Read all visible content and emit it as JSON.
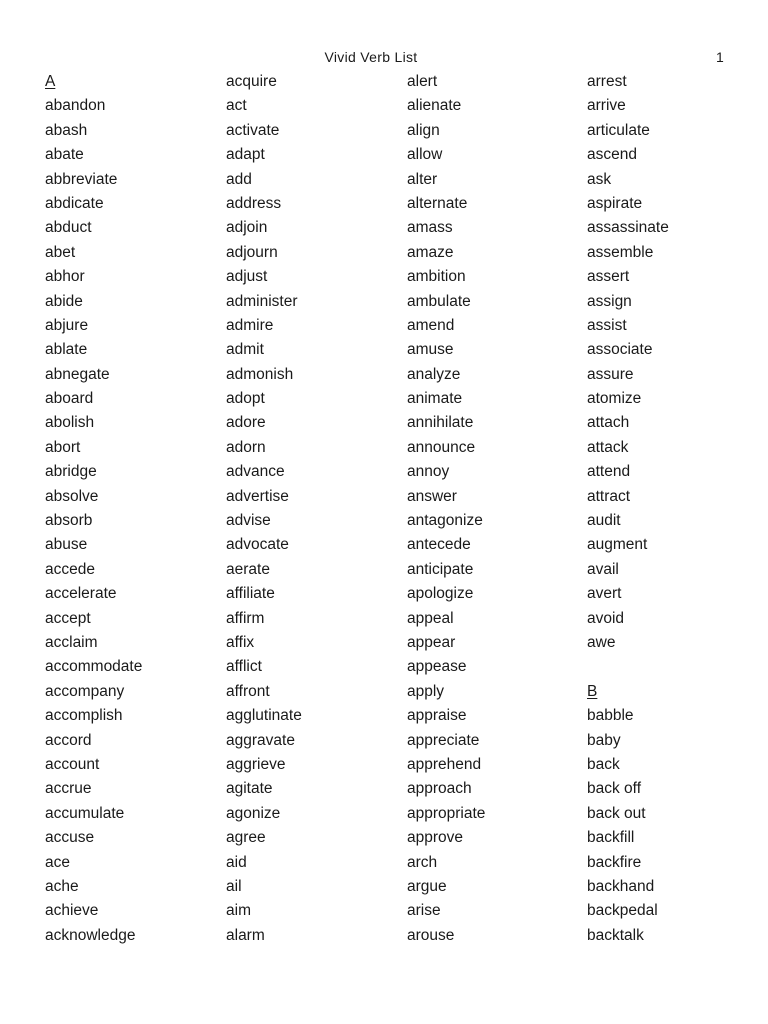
{
  "header": {
    "title": "Vivid Verb List",
    "page_number": "1"
  },
  "columns": [
    [
      {
        "type": "heading",
        "text": "A"
      },
      {
        "type": "word",
        "text": "abandon"
      },
      {
        "type": "word",
        "text": "abash"
      },
      {
        "type": "word",
        "text": "abate"
      },
      {
        "type": "word",
        "text": "abbreviate"
      },
      {
        "type": "word",
        "text": "abdicate"
      },
      {
        "type": "word",
        "text": "abduct"
      },
      {
        "type": "word",
        "text": "abet"
      },
      {
        "type": "word",
        "text": "abhor"
      },
      {
        "type": "word",
        "text": "abide"
      },
      {
        "type": "word",
        "text": "abjure"
      },
      {
        "type": "word",
        "text": "ablate"
      },
      {
        "type": "word",
        "text": "abnegate"
      },
      {
        "type": "word",
        "text": "aboard"
      },
      {
        "type": "word",
        "text": "abolish"
      },
      {
        "type": "word",
        "text": "abort"
      },
      {
        "type": "word",
        "text": "abridge"
      },
      {
        "type": "word",
        "text": "absolve"
      },
      {
        "type": "word",
        "text": "absorb"
      },
      {
        "type": "word",
        "text": "abuse"
      },
      {
        "type": "word",
        "text": "accede"
      },
      {
        "type": "word",
        "text": "accelerate"
      },
      {
        "type": "word",
        "text": "accept"
      },
      {
        "type": "word",
        "text": "acclaim"
      },
      {
        "type": "word",
        "text": "accommodate"
      },
      {
        "type": "word",
        "text": "accompany"
      },
      {
        "type": "word",
        "text": "accomplish"
      },
      {
        "type": "word",
        "text": "accord"
      },
      {
        "type": "word",
        "text": "account"
      },
      {
        "type": "word",
        "text": "accrue"
      },
      {
        "type": "word",
        "text": "accumulate"
      },
      {
        "type": "word",
        "text": "accuse"
      },
      {
        "type": "word",
        "text": "ace"
      },
      {
        "type": "word",
        "text": "ache"
      },
      {
        "type": "word",
        "text": "achieve"
      },
      {
        "type": "word",
        "text": "acknowledge"
      }
    ],
    [
      {
        "type": "word",
        "text": "acquire"
      },
      {
        "type": "word",
        "text": "act"
      },
      {
        "type": "word",
        "text": "activate"
      },
      {
        "type": "word",
        "text": "adapt"
      },
      {
        "type": "word",
        "text": "add"
      },
      {
        "type": "word",
        "text": "address"
      },
      {
        "type": "word",
        "text": "adjoin"
      },
      {
        "type": "word",
        "text": "adjourn"
      },
      {
        "type": "word",
        "text": "adjust"
      },
      {
        "type": "word",
        "text": "administer"
      },
      {
        "type": "word",
        "text": "admire"
      },
      {
        "type": "word",
        "text": "admit"
      },
      {
        "type": "word",
        "text": "admonish"
      },
      {
        "type": "word",
        "text": "adopt"
      },
      {
        "type": "word",
        "text": "adore"
      },
      {
        "type": "word",
        "text": "adorn"
      },
      {
        "type": "word",
        "text": "advance"
      },
      {
        "type": "word",
        "text": "advertise"
      },
      {
        "type": "word",
        "text": "advise"
      },
      {
        "type": "word",
        "text": "advocate"
      },
      {
        "type": "word",
        "text": "aerate"
      },
      {
        "type": "word",
        "text": "affiliate"
      },
      {
        "type": "word",
        "text": "affirm"
      },
      {
        "type": "word",
        "text": "affix"
      },
      {
        "type": "word",
        "text": "afflict"
      },
      {
        "type": "word",
        "text": "affront"
      },
      {
        "type": "word",
        "text": "agglutinate"
      },
      {
        "type": "word",
        "text": "aggravate"
      },
      {
        "type": "word",
        "text": "aggrieve"
      },
      {
        "type": "word",
        "text": "agitate"
      },
      {
        "type": "word",
        "text": "agonize"
      },
      {
        "type": "word",
        "text": "agree"
      },
      {
        "type": "word",
        "text": "aid"
      },
      {
        "type": "word",
        "text": "ail"
      },
      {
        "type": "word",
        "text": "aim"
      },
      {
        "type": "word",
        "text": "alarm"
      }
    ],
    [
      {
        "type": "word",
        "text": "alert"
      },
      {
        "type": "word",
        "text": "alienate"
      },
      {
        "type": "word",
        "text": "align"
      },
      {
        "type": "word",
        "text": "allow"
      },
      {
        "type": "word",
        "text": "alter"
      },
      {
        "type": "word",
        "text": "alternate"
      },
      {
        "type": "word",
        "text": "amass"
      },
      {
        "type": "word",
        "text": "amaze"
      },
      {
        "type": "word",
        "text": "ambition"
      },
      {
        "type": "word",
        "text": "ambulate"
      },
      {
        "type": "word",
        "text": "amend"
      },
      {
        "type": "word",
        "text": "amuse"
      },
      {
        "type": "word",
        "text": "analyze"
      },
      {
        "type": "word",
        "text": "animate"
      },
      {
        "type": "word",
        "text": "annihilate"
      },
      {
        "type": "word",
        "text": "announce"
      },
      {
        "type": "word",
        "text": "annoy"
      },
      {
        "type": "word",
        "text": "answer"
      },
      {
        "type": "word",
        "text": "antagonize"
      },
      {
        "type": "word",
        "text": "antecede"
      },
      {
        "type": "word",
        "text": "anticipate"
      },
      {
        "type": "word",
        "text": "apologize"
      },
      {
        "type": "word",
        "text": "appeal"
      },
      {
        "type": "word",
        "text": "appear"
      },
      {
        "type": "word",
        "text": "appease"
      },
      {
        "type": "word",
        "text": "apply"
      },
      {
        "type": "word",
        "text": "appraise"
      },
      {
        "type": "word",
        "text": "appreciate"
      },
      {
        "type": "word",
        "text": "apprehend"
      },
      {
        "type": "word",
        "text": "approach"
      },
      {
        "type": "word",
        "text": "appropriate"
      },
      {
        "type": "word",
        "text": "approve"
      },
      {
        "type": "word",
        "text": "arch"
      },
      {
        "type": "word",
        "text": "argue"
      },
      {
        "type": "word",
        "text": "arise"
      },
      {
        "type": "word",
        "text": "arouse"
      }
    ],
    [
      {
        "type": "word",
        "text": "arrest"
      },
      {
        "type": "word",
        "text": "arrive"
      },
      {
        "type": "word",
        "text": "articulate"
      },
      {
        "type": "word",
        "text": "ascend"
      },
      {
        "type": "word",
        "text": "ask"
      },
      {
        "type": "word",
        "text": "aspirate"
      },
      {
        "type": "word",
        "text": "assassinate"
      },
      {
        "type": "word",
        "text": "assemble"
      },
      {
        "type": "word",
        "text": "assert"
      },
      {
        "type": "word",
        "text": "assign"
      },
      {
        "type": "word",
        "text": "assist"
      },
      {
        "type": "word",
        "text": "associate"
      },
      {
        "type": "word",
        "text": "assure"
      },
      {
        "type": "word",
        "text": "atomize"
      },
      {
        "type": "word",
        "text": "attach"
      },
      {
        "type": "word",
        "text": "attack"
      },
      {
        "type": "word",
        "text": "attend"
      },
      {
        "type": "word",
        "text": "attract"
      },
      {
        "type": "word",
        "text": "audit"
      },
      {
        "type": "word",
        "text": "augment"
      },
      {
        "type": "word",
        "text": "avail"
      },
      {
        "type": "word",
        "text": "avert"
      },
      {
        "type": "word",
        "text": "avoid"
      },
      {
        "type": "word",
        "text": "awe"
      },
      {
        "type": "spacer",
        "text": ""
      },
      {
        "type": "heading",
        "text": "B"
      },
      {
        "type": "word",
        "text": "babble"
      },
      {
        "type": "word",
        "text": "baby"
      },
      {
        "type": "word",
        "text": "back"
      },
      {
        "type": "word",
        "text": "back off"
      },
      {
        "type": "word",
        "text": "back out"
      },
      {
        "type": "word",
        "text": "backfill"
      },
      {
        "type": "word",
        "text": "backfire"
      },
      {
        "type": "word",
        "text": "backhand"
      },
      {
        "type": "word",
        "text": "backpedal"
      },
      {
        "type": "word",
        "text": "backtalk"
      }
    ]
  ]
}
